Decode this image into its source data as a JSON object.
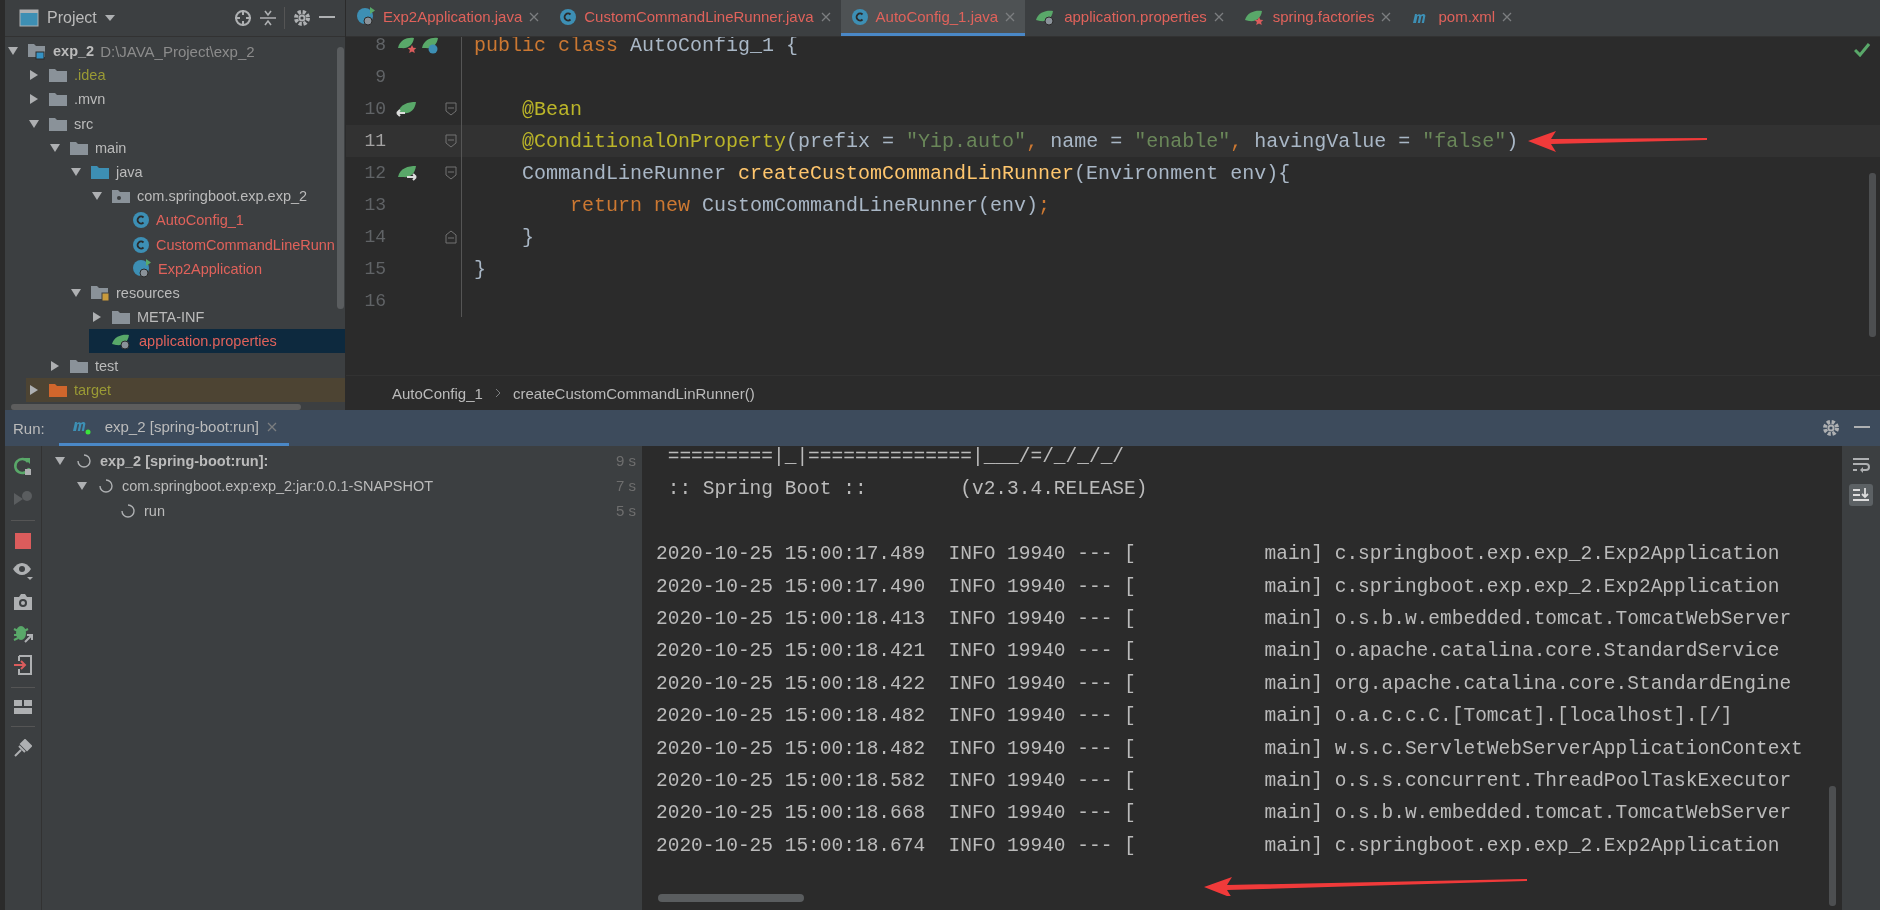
{
  "project_panel": {
    "title": "Project",
    "tree": [
      {
        "label": "exp_2",
        "kind": "module",
        "path": "D:\\JAVA_Project\\exp_2",
        "color": "#bbbbbb",
        "expanded": true,
        "selected": false,
        "children": [
          {
            "label": ".idea",
            "kind": "folder",
            "color": "#9a9a35",
            "expanded": false,
            "selected": false
          },
          {
            "label": ".mvn",
            "kind": "folder",
            "color": "#bbbbbb",
            "expanded": false,
            "selected": false
          },
          {
            "label": "src",
            "kind": "folder",
            "color": "#bbbbbb",
            "expanded": true,
            "selected": false,
            "children": [
              {
                "label": "main",
                "kind": "folder",
                "color": "#bbbbbb",
                "expanded": true,
                "selected": false,
                "children": [
                  {
                    "label": "java",
                    "kind": "source-folder",
                    "color": "#bbbbbb",
                    "expanded": true,
                    "selected": false,
                    "children": [
                      {
                        "label": "com.springboot.exp.exp_2",
                        "kind": "package",
                        "color": "#bbbbbb",
                        "expanded": true,
                        "selected": false,
                        "children": [
                          {
                            "label": "AutoConfig_1",
                            "kind": "class",
                            "color": "#e0625b",
                            "selected": false
                          },
                          {
                            "label": "CustomCommandLineRunn",
                            "kind": "class",
                            "color": "#e0625b",
                            "selected": false
                          },
                          {
                            "label": "Exp2Application",
                            "kind": "boot-class",
                            "color": "#e0625b",
                            "selected": false
                          }
                        ]
                      }
                    ]
                  },
                  {
                    "label": "resources",
                    "kind": "resource-folder",
                    "color": "#bbbbbb",
                    "expanded": true,
                    "selected": false,
                    "children": [
                      {
                        "label": "META-INF",
                        "kind": "folder",
                        "color": "#bbbbbb",
                        "expanded": false,
                        "selected": false
                      },
                      {
                        "label": "application.properties",
                        "kind": "properties",
                        "color": "#e0625b",
                        "selected": true
                      }
                    ]
                  }
                ]
              },
              {
                "label": "test",
                "kind": "folder",
                "color": "#bbbbbb",
                "expanded": false,
                "selected": false
              }
            ]
          },
          {
            "label": "target",
            "kind": "excluded-folder",
            "color": "#9a9a35",
            "expanded": false,
            "selected": false
          }
        ]
      }
    ]
  },
  "editor": {
    "tabs": [
      {
        "label": "Exp2Application.java",
        "kind": "boot-class",
        "selected": false
      },
      {
        "label": "CustomCommandLineRunner.java",
        "kind": "class",
        "selected": false
      },
      {
        "label": "AutoConfig_1.java",
        "kind": "class",
        "selected": true
      },
      {
        "label": "application.properties",
        "kind": "properties",
        "selected": false
      },
      {
        "label": "spring.factories",
        "kind": "factories",
        "selected": false
      },
      {
        "label": "pom.xml",
        "kind": "maven",
        "selected": false
      }
    ],
    "lines": [
      {
        "number": "8",
        "current": false,
        "gutter": {
          "kind": "config-class"
        },
        "tokens": [
          {
            "text": "public class ",
            "kind": "keyword"
          },
          {
            "text": "AutoConfig_1 {",
            "kind": "plain"
          }
        ]
      },
      {
        "number": "9",
        "current": false
      },
      {
        "number": "10",
        "current": false,
        "gutter": {
          "kind": "bean-method"
        },
        "fold": {
          "kind": "start"
        },
        "tokens": [
          {
            "text": "    @Bean",
            "kind": "annotation"
          }
        ]
      },
      {
        "number": "11",
        "current": true,
        "fold": {
          "kind": "start"
        },
        "tokens": [
          {
            "text": "    @ConditionalOnProperty",
            "kind": "annotation"
          },
          {
            "text": "(prefix = ",
            "kind": "plain"
          },
          {
            "text": "\"Yip.auto\"",
            "kind": "string"
          },
          {
            "text": ", ",
            "kind": "keyword"
          },
          {
            "text": "name = ",
            "kind": "plain"
          },
          {
            "text": "\"enable\"",
            "kind": "string"
          },
          {
            "text": ", ",
            "kind": "keyword"
          },
          {
            "text": "havingValue = ",
            "kind": "plain"
          },
          {
            "text": "\"false\"",
            "kind": "string"
          },
          {
            "text": ")",
            "kind": "plain"
          }
        ]
      },
      {
        "number": "12",
        "current": false,
        "gutter": {
          "kind": "bean-link"
        },
        "fold": {
          "kind": "start"
        },
        "tokens": [
          {
            "text": "    CommandLineRunner ",
            "kind": "plain"
          },
          {
            "text": "createCustomCommandLinRunner",
            "kind": "method"
          },
          {
            "text": "(Environment env){",
            "kind": "plain"
          }
        ]
      },
      {
        "number": "13",
        "current": false,
        "tokens": [
          {
            "text": "        return new ",
            "kind": "keyword"
          },
          {
            "text": "CustomCommandLineRunner(env)",
            "kind": "plain"
          },
          {
            "text": ";",
            "kind": "keyword"
          }
        ]
      },
      {
        "number": "14",
        "current": false,
        "fold": {
          "kind": "end"
        },
        "tokens": [
          {
            "text": "    }",
            "kind": "plain"
          }
        ]
      },
      {
        "number": "15",
        "current": false,
        "tokens": [
          {
            "text": "}",
            "kind": "plain"
          }
        ]
      },
      {
        "number": "16",
        "current": false
      }
    ],
    "breadcrumbs": [
      "AutoConfig_1",
      "createCustomCommandLinRunner()"
    ]
  },
  "run_panel": {
    "label": "Run:",
    "tabs": [
      {
        "label": "exp_2 [spring-boot:run]",
        "selected": true
      }
    ],
    "tree": [
      {
        "label": "exp_2 [spring-boot:run]:",
        "time": "9 s",
        "expanded": true,
        "children": [
          {
            "label": "com.springboot.exp:exp_2:jar:0.0.1-SNAPSHOT",
            "time": "7 s",
            "expanded": true,
            "children": [
              {
                "label": "run",
                "time": "5 s"
              }
            ]
          }
        ]
      }
    ],
    "console_banner": [
      " =========|_|==============|___/=/_/_/_/",
      " :: Spring Boot ::        (v2.3.4.RELEASE)"
    ],
    "console_lines": [
      "2020-10-25 15:00:17.489  INFO 19940 --- [           main] c.springboot.exp.exp_2.Exp2Application",
      "2020-10-25 15:00:17.490  INFO 19940 --- [           main] c.springboot.exp.exp_2.Exp2Application",
      "2020-10-25 15:00:18.413  INFO 19940 --- [           main] o.s.b.w.embedded.tomcat.TomcatWebServer",
      "2020-10-25 15:00:18.421  INFO 19940 --- [           main] o.apache.catalina.core.StandardService",
      "2020-10-25 15:00:18.422  INFO 19940 --- [           main] org.apache.catalina.core.StandardEngine",
      "2020-10-25 15:00:18.482  INFO 19940 --- [           main] o.a.c.c.C.[Tomcat].[localhost].[/]",
      "2020-10-25 15:00:18.482  INFO 19940 --- [           main] w.s.c.ServletWebServerApplicationContext",
      "2020-10-25 15:00:18.582  INFO 19940 --- [           main] o.s.s.concurrent.ThreadPoolTaskExecutor",
      "2020-10-25 15:00:18.668  INFO 19940 --- [           main] o.s.b.w.embedded.tomcat.TomcatWebServer",
      "2020-10-25 15:00:18.674  INFO 19940 --- [           main] c.springboot.exp.exp_2.Exp2Application"
    ]
  }
}
